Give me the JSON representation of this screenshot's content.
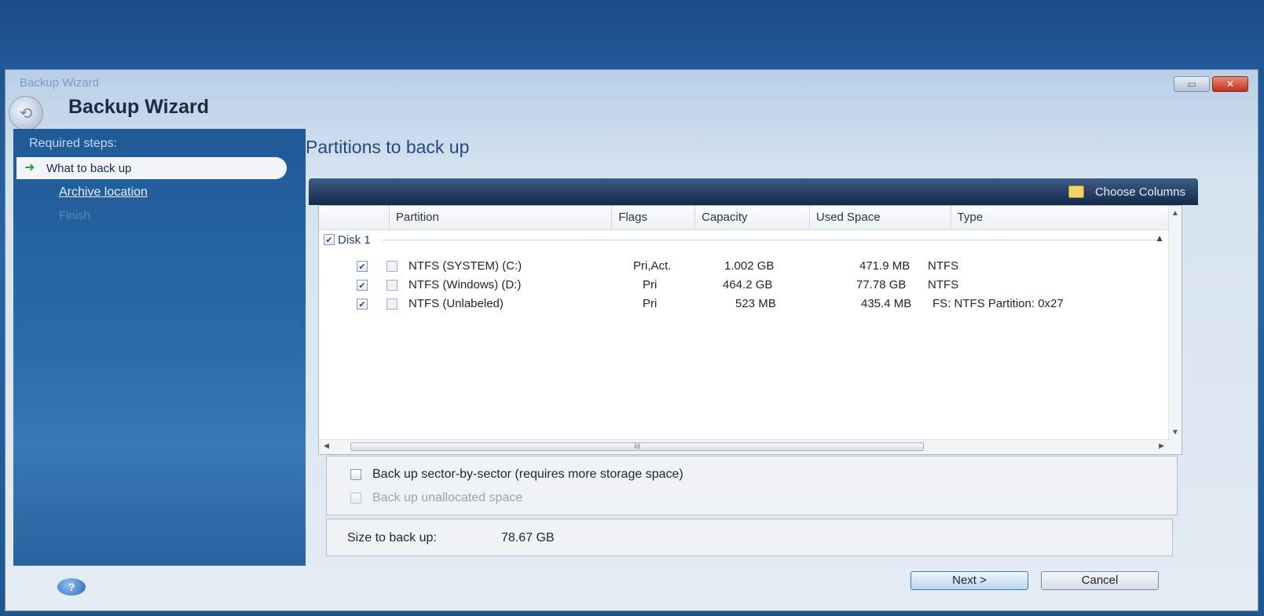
{
  "window": {
    "titlebar_text": "Backup Wizard",
    "title": "Backup Wizard",
    "restore_label": "▭",
    "close_label": "✕"
  },
  "sidebar": {
    "heading": "Required steps:",
    "steps": [
      {
        "label": "What to back up",
        "state": "active"
      },
      {
        "label": "Archive location",
        "state": "link"
      },
      {
        "label": "Finish",
        "state": "disabled"
      }
    ]
  },
  "content": {
    "title": "Partitions to back up",
    "choose_columns": "Choose Columns",
    "columns": [
      "",
      "Partition",
      "Flags",
      "Capacity",
      "Used Space",
      "Type"
    ],
    "disk_label": "Disk 1",
    "rows": [
      {
        "partition": "NTFS (SYSTEM) (C:)",
        "flags": "Pri,Act.",
        "capacity": "1.002 GB",
        "used": "471.9 MB",
        "type": "NTFS",
        "checked": true
      },
      {
        "partition": "NTFS (Windows) (D:)",
        "flags": "Pri",
        "capacity": "464.2 GB",
        "used": "77.78 GB",
        "type": "NTFS",
        "checked": true
      },
      {
        "partition": "NTFS (Unlabeled)",
        "flags": "Pri",
        "capacity": "523 MB",
        "used": "435.4 MB",
        "type": "FS: NTFS Partition: 0x27",
        "checked": true
      }
    ],
    "scroll_grip": "III"
  },
  "options": {
    "sector_by_sector": "Back up sector-by-sector (requires more storage space)",
    "unallocated": "Back up unallocated space"
  },
  "size": {
    "label": "Size to back up:",
    "value": "78.67 GB"
  },
  "buttons": {
    "help": "?",
    "next": "Next >",
    "cancel": "Cancel"
  }
}
